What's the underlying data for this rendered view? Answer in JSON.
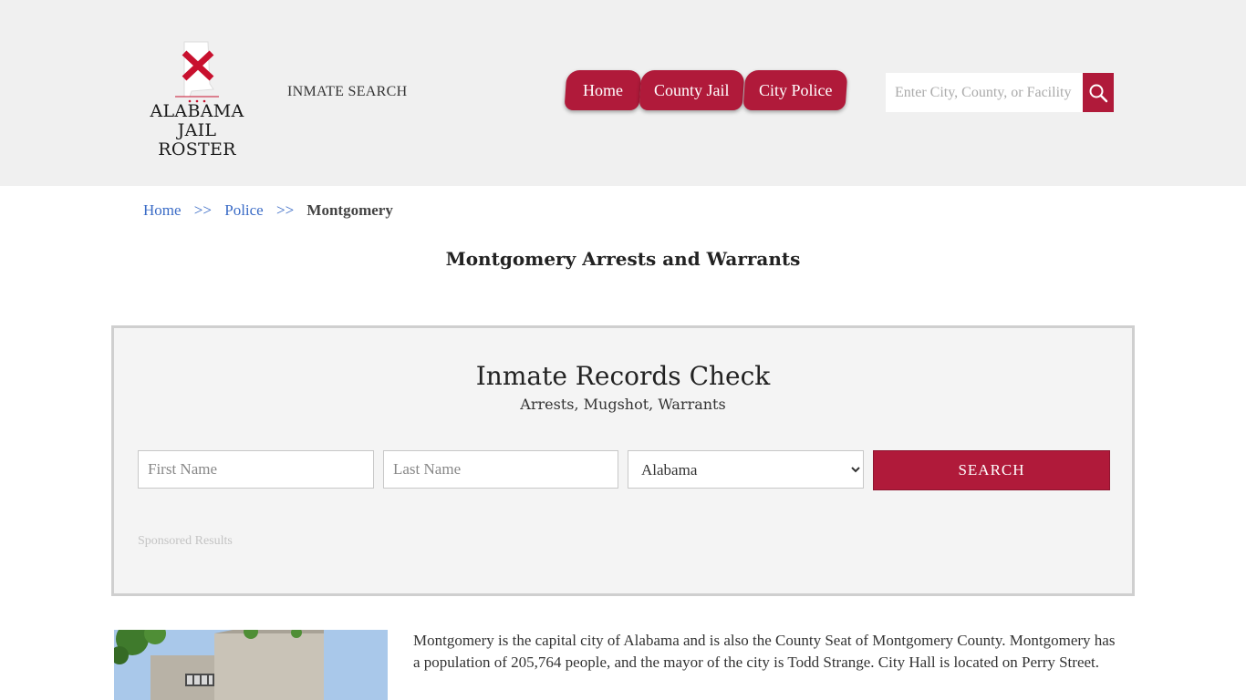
{
  "header": {
    "logo_line1": "ALABAMA",
    "logo_line2": "JAIL ROSTER",
    "inmate_search_link": "INMATE SEARCH",
    "nav": [
      {
        "label": "Home"
      },
      {
        "label": "County Jail"
      },
      {
        "label": "City Police"
      }
    ],
    "search_placeholder": "Enter City, County, or Facility"
  },
  "breadcrumb": {
    "home": "Home",
    "sep": ">>",
    "police": "Police",
    "current": "Montgomery"
  },
  "page_title": "Montgomery Arrests and Warrants",
  "records": {
    "title": "Inmate Records Check",
    "subtitle": "Arrests, Mugshot, Warrants",
    "first_name_placeholder": "First Name",
    "last_name_placeholder": "Last Name",
    "state_selected": "Alabama",
    "search_button": "SEARCH",
    "sponsored": "Sponsored Results"
  },
  "about": {
    "text": "Montgomery is the capital city of Alabama and is also the County Seat of Montgomery County. Montgomery has a population of 205,764 people, and the mayor of the city is Todd Strange. City Hall is located on Perry Street."
  },
  "colors": {
    "accent": "#b01a3a",
    "header_bg": "#f0f0f0",
    "link": "#3a6bc6"
  },
  "icons": {
    "search": "magnifier-icon",
    "logo": "alabama-flag-map-icon"
  }
}
